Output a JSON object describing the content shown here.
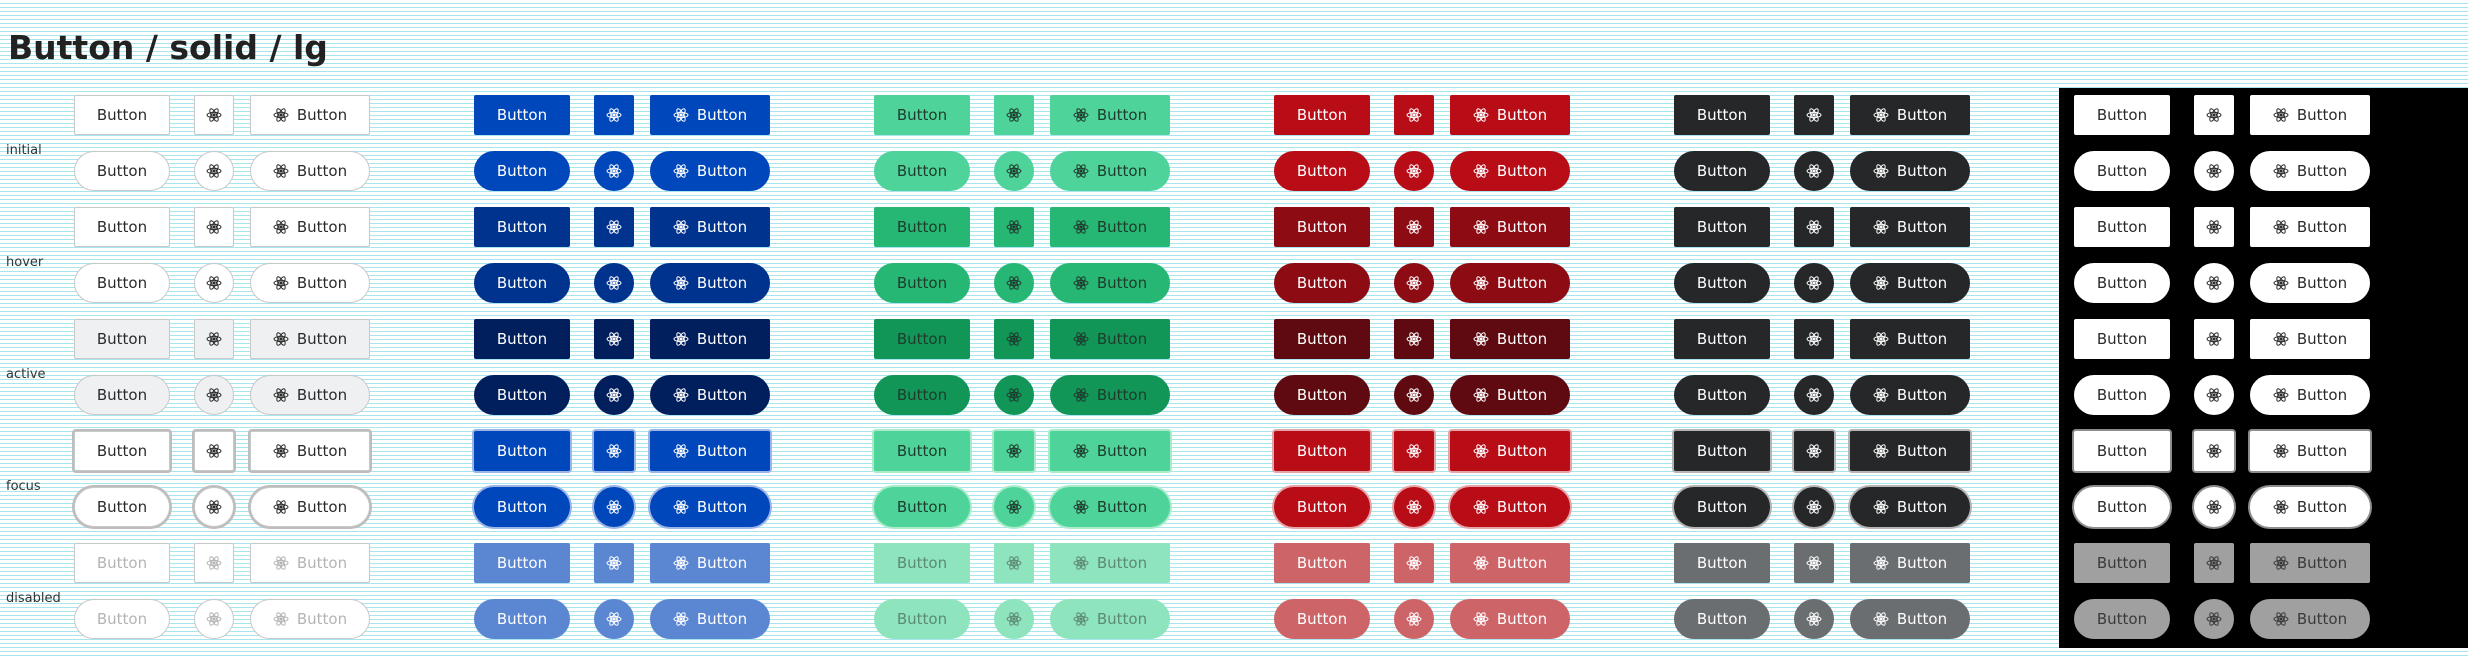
{
  "title": "Button / solid / lg",
  "button_label": "Button",
  "icon": "atom-icon",
  "states": [
    "initial",
    "hover",
    "active",
    "focus",
    "disabled"
  ],
  "shapes": [
    "rectangle",
    "pill"
  ],
  "variants": [
    {
      "name": "default",
      "text": "#2b2b2b",
      "border": "#c8c8c8",
      "states": {
        "initial": "#ffffff",
        "hover": "#ffffff",
        "active": "#eef0f2",
        "focus": "#ffffff",
        "disabled": "#ffffff"
      },
      "focus_ring": "#bdbdbd",
      "disabled_text": "#b4b4b4"
    },
    {
      "name": "primary",
      "text": "#ffffff",
      "states": {
        "initial": "#0047bb",
        "hover": "#00338d",
        "active": "#001f5c",
        "focus": "#0047bb",
        "disabled": "#5a86d2"
      },
      "focus_ring": "#9bb5e6"
    },
    {
      "name": "success",
      "text": "#1f3b2c",
      "states": {
        "initial": "#4ed49a",
        "hover": "#27b774",
        "active": "#119658",
        "focus": "#4ed49a",
        "disabled": "#8de4bd"
      },
      "focus_ring": "#a8ecc9",
      "disabled_text": "#5d8a73"
    },
    {
      "name": "danger",
      "text": "#ffffff",
      "states": {
        "initial": "#b80c17",
        "hover": "#8d0c14",
        "active": "#5f0a10",
        "focus": "#b80c17",
        "disabled": "#cd6468"
      },
      "focus_ring": "#e7a5a8"
    },
    {
      "name": "dark",
      "text": "#ffffff",
      "states": {
        "initial": "#252729",
        "hover": "#252729",
        "active": "#252729",
        "focus": "#252729",
        "disabled": "#6b6e70"
      },
      "focus_ring": "#b5b5b5"
    },
    {
      "name": "inverse",
      "text": "#2b2b2b",
      "states": {
        "initial": "#ffffff",
        "hover": "#ffffff",
        "active": "#ffffff",
        "focus": "#ffffff",
        "disabled": "#a0a0a0"
      },
      "focus_ring": "#8c8c8c",
      "disabled_text": "#3a3a3a"
    }
  ]
}
